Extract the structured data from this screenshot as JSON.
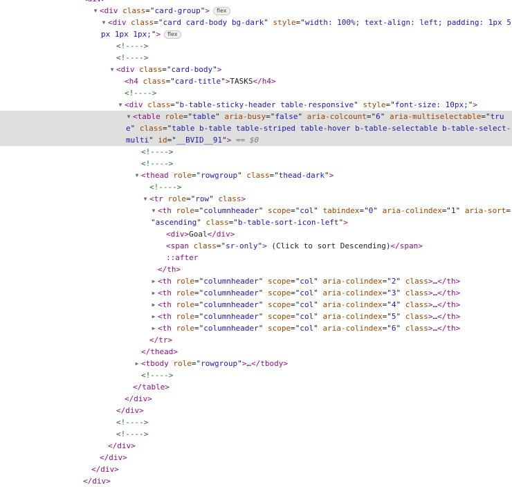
{
  "elements_panel": {
    "lines": [
      {
        "k": "tag-open-partial",
        "text": "<div>"
      },
      {
        "k": "open",
        "tag": "div",
        "attrs": [
          [
            "class",
            "card-group"
          ]
        ],
        "badge": "flex"
      },
      {
        "k": "open",
        "tag": "div",
        "attrs": [
          [
            "class",
            "card card-body bg-dark"
          ],
          [
            "style",
            "width: 100%; text-align: left; padding: 1px 5"
          ]
        ],
        "wrap": "px 1px 1px;\">",
        "badge": "flex"
      },
      {
        "k": "comment",
        "text": "<!---->"
      },
      {
        "k": "comment",
        "text": "<!---->"
      },
      {
        "k": "open",
        "tag": "div",
        "attrs": [
          [
            "class",
            "card-body"
          ]
        ]
      },
      {
        "k": "inline",
        "tag": "h4",
        "attrs": [
          [
            "class",
            "card-title"
          ]
        ],
        "content": "TASKS"
      },
      {
        "k": "comment",
        "text": "<!---->"
      },
      {
        "k": "open",
        "tag": "div",
        "attrs": [
          [
            "class",
            "b-table-sticky-header table-responsive"
          ],
          [
            "style",
            "font-size: 10px;"
          ]
        ]
      },
      {
        "k": "selected",
        "line1": "<table role=\"table\" aria-busy=\"false\" aria-colcount=\"6\" aria-multiselectable=\"tru",
        "line2": "e\" class=\"table b-table table-striped table-hover b-table-selectable b-table-select-",
        "line3": "multi\" id=\"__BVID__91\"> == $0"
      },
      {
        "k": "comment",
        "text": "<!---->"
      },
      {
        "k": "comment",
        "text": "<!---->"
      },
      {
        "k": "open",
        "tag": "thead",
        "attrs": [
          [
            "role",
            "rowgroup"
          ],
          [
            "class",
            "thead-dark"
          ]
        ]
      },
      {
        "k": "comment",
        "text": "<!---->"
      },
      {
        "k": "open",
        "tag": "tr",
        "attrs": [
          [
            "role",
            "row"
          ],
          [
            "class",
            ""
          ]
        ]
      },
      {
        "k": "open",
        "tag": "th",
        "attrs": [
          [
            "role",
            "columnheader"
          ],
          [
            "scope",
            "col"
          ],
          [
            "tabindex",
            "0"
          ],
          [
            "aria-colindex",
            "1"
          ],
          [
            "aria-sort",
            ""
          ]
        ],
        "wrap": "\"ascending\" class=\"b-table-sort-icon-left\">"
      },
      {
        "k": "inline",
        "tag": "div",
        "attrs": [],
        "content": "Goal"
      },
      {
        "k": "inline",
        "tag": "span",
        "attrs": [
          [
            "class",
            "sr-only"
          ]
        ],
        "content": " (Click to sort Descending)"
      },
      {
        "k": "pseudo",
        "text": "::after"
      },
      {
        "k": "close",
        "tag": "th"
      },
      {
        "k": "collapsed",
        "tag": "th",
        "attrs": [
          [
            "role",
            "columnheader"
          ],
          [
            "scope",
            "col"
          ],
          [
            "aria-colindex",
            "2"
          ]
        ]
      },
      {
        "k": "collapsed",
        "tag": "th",
        "attrs": [
          [
            "role",
            "columnheader"
          ],
          [
            "scope",
            "col"
          ],
          [
            "aria-colindex",
            "3"
          ]
        ]
      },
      {
        "k": "collapsed",
        "tag": "th",
        "attrs": [
          [
            "role",
            "columnheader"
          ],
          [
            "scope",
            "col"
          ],
          [
            "aria-colindex",
            "4"
          ]
        ]
      },
      {
        "k": "collapsed",
        "tag": "th",
        "attrs": [
          [
            "role",
            "columnheader"
          ],
          [
            "scope",
            "col"
          ],
          [
            "aria-colindex",
            "5"
          ]
        ]
      },
      {
        "k": "collapsed",
        "tag": "th",
        "attrs": [
          [
            "role",
            "columnheader"
          ],
          [
            "scope",
            "col"
          ],
          [
            "aria-colindex",
            "6"
          ]
        ]
      },
      {
        "k": "close",
        "tag": "tr"
      },
      {
        "k": "close",
        "tag": "thead"
      },
      {
        "k": "collapsed-body",
        "tag": "tbody",
        "attrs": [
          [
            "role",
            "rowgroup"
          ]
        ]
      },
      {
        "k": "comment",
        "text": "<!---->"
      },
      {
        "k": "close",
        "tag": "table"
      },
      {
        "k": "close",
        "tag": "div"
      },
      {
        "k": "close",
        "tag": "div"
      },
      {
        "k": "comment",
        "text": "<!---->"
      },
      {
        "k": "comment",
        "text": "<!---->"
      },
      {
        "k": "close",
        "tag": "div"
      },
      {
        "k": "close",
        "tag": "div"
      },
      {
        "k": "close",
        "tag": "div"
      },
      {
        "k": "close",
        "tag": "div"
      }
    ]
  },
  "text": {
    "l0": "<div",
    "l1_tag": "div",
    "l1_attr": "class",
    "l1_val": "card-group",
    "badge_flex": "flex",
    "l2_tag": "div",
    "l2_attr1": "class",
    "l2_val1": "card card-body bg-dark",
    "l2_attr2": "style",
    "l2_val2": "width: 100%; text-align: left; padding: 1px 5",
    "l2b_val": "px 1px 1px;",
    "comment": "<!---->",
    "l5_tag": "div",
    "l5_attr": "class",
    "l5_val": "card-body",
    "l6_tag": "h4",
    "l6_attr": "class",
    "l6_val": "card-title",
    "l6_text": "TASKS",
    "l8_tag": "div",
    "l8_attr1": "class",
    "l8_val1": "b-table-sticky-header table-responsive",
    "l8_attr2": "style",
    "l8_val2": "font-size: 10px;",
    "sel_tag": "table",
    "sel_a1": "role",
    "sel_v1": "table",
    "sel_a2": "aria-busy",
    "sel_v2": "false",
    "sel_a3": "aria-colcount",
    "sel_v3": "6",
    "sel_a4": "aria-multiselectable",
    "sel_v4a": "tru",
    "sel_v4b": "e",
    "sel_a5": "class",
    "sel_v5a": "table b-table table-striped table-hover b-table-selectable b-table-select-",
    "sel_v5b": "multi",
    "sel_a6": "id",
    "sel_v6": "__BVID__91",
    "sel_eq": "== $0",
    "thead_tag": "thead",
    "thead_a1": "role",
    "thead_v1": "rowgroup",
    "thead_a2": "class",
    "thead_v2": "thead-dark",
    "tr_tag": "tr",
    "tr_a1": "role",
    "tr_v1": "row",
    "tr_a2": "class",
    "th_tag": "th",
    "th_a1": "role",
    "th_v1": "columnheader",
    "th_a2": "scope",
    "th_v2": "col",
    "th_a3": "tabindex",
    "th_v3": "0",
    "th_a4": "aria-colindex",
    "th_v4": "1",
    "th_a5": "aria-sort",
    "th2_val": "ascending",
    "th2_attr": "class",
    "th2_cls": "b-table-sort-icon-left",
    "goal_tag": "div",
    "goal_text": "Goal",
    "span_tag": "span",
    "span_attr": "class",
    "span_val": "sr-only",
    "span_text": " (Click to sort Descending)",
    "after": "::after",
    "col_a3": "aria-colindex",
    "col_idx": [
      "2",
      "3",
      "4",
      "5",
      "6"
    ],
    "col_class": "class",
    "ellipsis": "…",
    "tbody_tag": "tbody",
    "tbody_a1": "role",
    "tbody_v1": "rowgroup",
    "close_th": "th",
    "close_tr": "tr",
    "close_thead": "thead",
    "close_table": "table",
    "close_div": "div"
  }
}
